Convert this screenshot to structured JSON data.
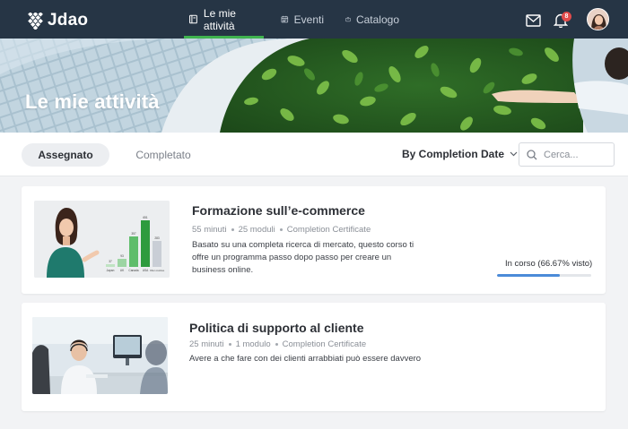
{
  "brand": {
    "name": "Jdao"
  },
  "nav": {
    "tabs": [
      {
        "label": "Le mie attività",
        "icon": "book-icon",
        "active": true
      },
      {
        "label": "Eventi",
        "icon": "calendar-icon",
        "active": false
      },
      {
        "label": "Catalogo",
        "icon": "catalog-icon",
        "active": false
      }
    ],
    "notifications_count": "8"
  },
  "hero": {
    "title": "Le mie attività"
  },
  "filters": {
    "tabs": [
      {
        "label": "Assegnato",
        "active": true
      },
      {
        "label": "Completato",
        "active": false
      }
    ],
    "sort_label": "By Completion Date",
    "search_placeholder": "Cerca..."
  },
  "courses": [
    {
      "title": "Formazione sull’e-commerce",
      "meta": [
        "55 minuti",
        "25 moduli",
        "Completion Certificate"
      ],
      "description": "Basato su una completa ricerca di mercato, questo corso ti offre un programma passo dopo passo per creare un business online.",
      "status": "In corso (66.67% visto)",
      "progress": 0.6667,
      "thumbnail": {
        "bar_values": [
          "37",
          "93",
          "357",
          "651",
          "283"
        ],
        "bar_labels": [
          "Japan",
          "UK",
          "Canada",
          "USA",
          "Other countries"
        ]
      }
    },
    {
      "title": "Politica di supporto al cliente",
      "meta": [
        "25 minuti",
        "1 modulo",
        "Completion Certificate"
      ],
      "description": "Avere a che fare con dei clienti arrabbiati può essere davvero"
    }
  ],
  "colors": {
    "nav_bg": "#263545",
    "active_tab_accent": "#3fb34f",
    "progress": "#4b8bd8",
    "badge": "#e24b4b"
  }
}
